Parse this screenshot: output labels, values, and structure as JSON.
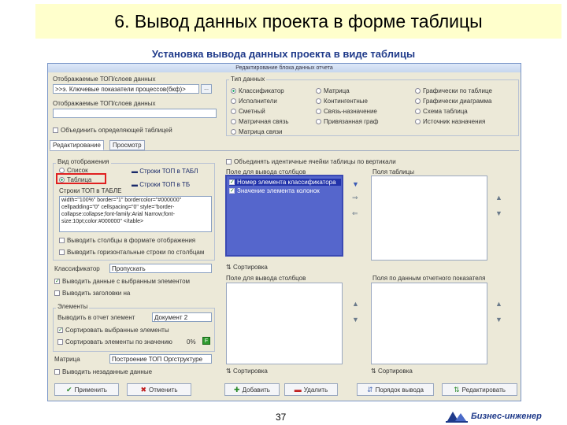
{
  "slide": {
    "title": "6. Вывод данных проекта в форме таблицы",
    "subtitle": "Установка вывода данных проекта в виде таблицы",
    "page_number": "37",
    "brand": "Бизнес-инженер"
  },
  "dialog": {
    "title": "Редактирование блока данных отчета",
    "objects_label": "Отображаемые ТОП/слоев данных",
    "object_value": ">>э. Ключевые показатели процессов(бкф)>",
    "object_btn": "...",
    "objects_label2": "Отображаемые ТОП/слоев данных",
    "merge_check": "Объединить определяющей таблицей",
    "tabs": [
      "Редактирование",
      "Просмотр"
    ],
    "type_group": "Тип данных",
    "types": [
      "Классификатор",
      "Матрица",
      "Графически по таблице",
      "Исполнители",
      "Контингентные",
      "Графически диаграмма",
      "Сметный",
      "Связь-назначение",
      "Схема таблица",
      "Матричная связь",
      "Привязанная граф",
      "Источник назначения",
      "Матрица связи"
    ],
    "output_group": "Вид отображения",
    "view_list": "Список",
    "view_table": "Таблица",
    "row_tog": "Строки ТОП в ТАБЛ",
    "row_tog2": "Строки ТОП в ТБ",
    "tog_label": "Строки ТОП в ТАБЛЕ",
    "code_text": "width=\"100%\" border=\"1\" bordercolor=\"#000000\" cellpadding=\"0\" cellspacing=\"0\" style=\"border-collapse:collapse;font-family:Arial Narrow;font-size:10pt;color:#000000\" </table>",
    "cb_cols": "Выводить столбцы в формате отображения",
    "cb_rows": "Выводить горизонтальные строки по столбцам",
    "sort_label": "Классификатор",
    "sort_value": "Пропускать",
    "cb_repeat": "Выводить данные с выбранным элементом",
    "cb_title": "Выводить заголовки на",
    "elements_group": "Элементы",
    "show_label": "Выводить в отчет элемент",
    "show_value": "Документ 2",
    "cb_sort_sel": "Сортировать выбранные элементы",
    "cb_sort2": "Сортировать элементы по значению",
    "pct": "0%",
    "matrix_label": "Матрица",
    "matrix_value": "Построение ТОП Оргструктуре",
    "cb_empty": "Выводить незаданные данные",
    "merge_cols": "Объединять идентичные ячейки таблицы по вертикали",
    "left_list_label": "Поле для вывода столбцов",
    "right_list_label": "Поля таблицы",
    "sel_items": [
      "Номер элемента классификатора",
      "Значение элемента колонок"
    ],
    "sort_btn": "Сортировка",
    "left_list2_label": "Поле для вывода столбцов",
    "right_list2_label": "Поля по данным отчетного показателя",
    "sort_btn2": "Сортировка",
    "sort_btn3": "Сортировка",
    "bottom_buttons": [
      "Применить",
      "Отменить",
      "Добавить",
      "Удалить",
      "Порядок вывода",
      "Редактировать"
    ]
  },
  "colors": {
    "title_bg": "#ffffcc",
    "subtitle": "#1f3a8a",
    "highlight": "#e02020",
    "list_sel": "#5566cc"
  }
}
